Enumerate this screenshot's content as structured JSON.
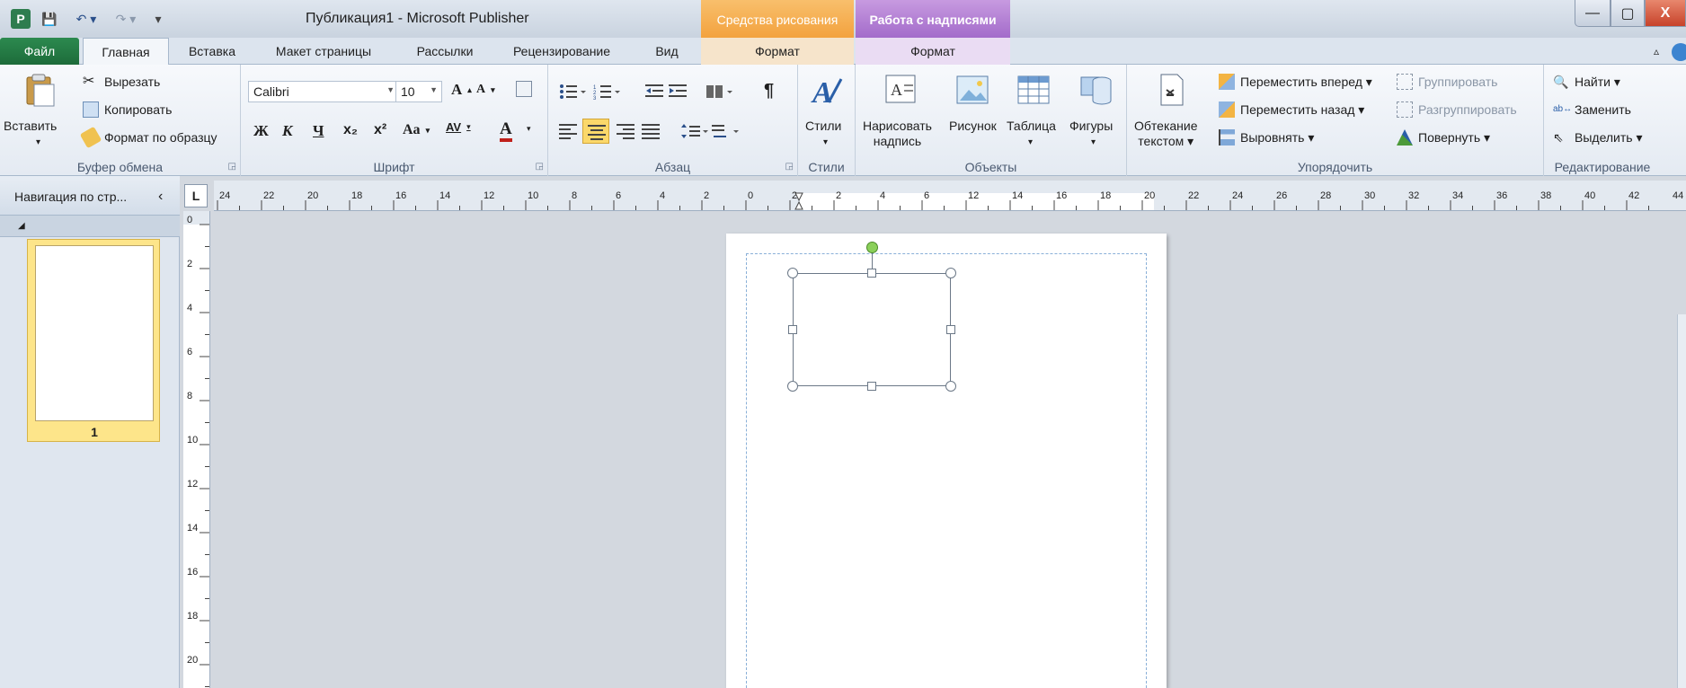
{
  "window": {
    "title": "Публикация1  -  Microsoft Publisher",
    "app_icon": "P",
    "minimize": "—",
    "maximize": "▢",
    "close": "X"
  },
  "quick_access": {
    "save_icon": "💾",
    "undo_icon": "↶ ▾",
    "redo_icon": "↷ ▾",
    "customize_icon": "▾"
  },
  "context_tabs": {
    "drawing_tools": "Средства рисования",
    "text_box_tools": "Работа с надписями",
    "format_label": "Формат"
  },
  "tabs": {
    "file": "Файл",
    "home": "Главная",
    "insert": "Вставка",
    "page_layout": "Макет страницы",
    "mailings": "Рассылки",
    "review": "Рецензирование",
    "view": "Вид",
    "format_drawing": "Формат",
    "format_text": "Формат",
    "collapse": "▵"
  },
  "clipboard": {
    "paste": "Вставить",
    "cut": "Вырезать",
    "copy": "Копировать",
    "format_painter": "Формат по образцу",
    "group_label": "Буфер обмена"
  },
  "font": {
    "font_name": "Calibri",
    "font_size": "10",
    "grow": "A",
    "shrink": "A",
    "bold": "Ж",
    "italic": "К",
    "underline": "Ч",
    "subscript": "x₂",
    "superscript": "x²",
    "change_case": "Aa",
    "spacing": "AV",
    "color": "A",
    "group_label": "Шрифт"
  },
  "paragraph": {
    "pilcrow": "¶",
    "group_label": "Абзац"
  },
  "styles": {
    "label": "Стили",
    "group_label": "Стили"
  },
  "objects": {
    "draw_text_box": "Нарисовать\nнадпись",
    "picture": "Рисунок",
    "table": "Таблица",
    "shapes": "Фигуры",
    "group_label": "Объекты"
  },
  "arrange": {
    "wrap_text": "Обтекание\nтекстом ▾",
    "bring_forward": "Переместить вперед ▾",
    "send_backward": "Переместить назад ▾",
    "align": "Выровнять ▾",
    "group": "Группировать",
    "ungroup": "Разгруппировать",
    "rotate": "Повернуть ▾",
    "group_label": "Упорядочить"
  },
  "editing": {
    "find": "Найти ▾",
    "replace": "Заменить",
    "select": "Выделить ▾",
    "group_label": "Редактирование"
  },
  "nav_pane": {
    "title": "Навигация по стр...",
    "close": "‹",
    "section": "◢",
    "page_number": "1"
  },
  "ruler": {
    "corner": "L",
    "h_labels": [
      "24",
      "22",
      "20",
      "18",
      "16",
      "14",
      "12",
      "10",
      "8",
      "6",
      "4",
      "2",
      "0",
      "2",
      "2",
      "4",
      "6",
      "12",
      "14",
      "16",
      "18",
      "20",
      "22",
      "24",
      "26",
      "28",
      "30",
      "32",
      "34",
      "36",
      "38",
      "40",
      "42",
      "44"
    ],
    "v_labels": [
      "0",
      "2",
      "4",
      "6",
      "8",
      "10",
      "12",
      "14",
      "16",
      "18",
      "20"
    ]
  }
}
